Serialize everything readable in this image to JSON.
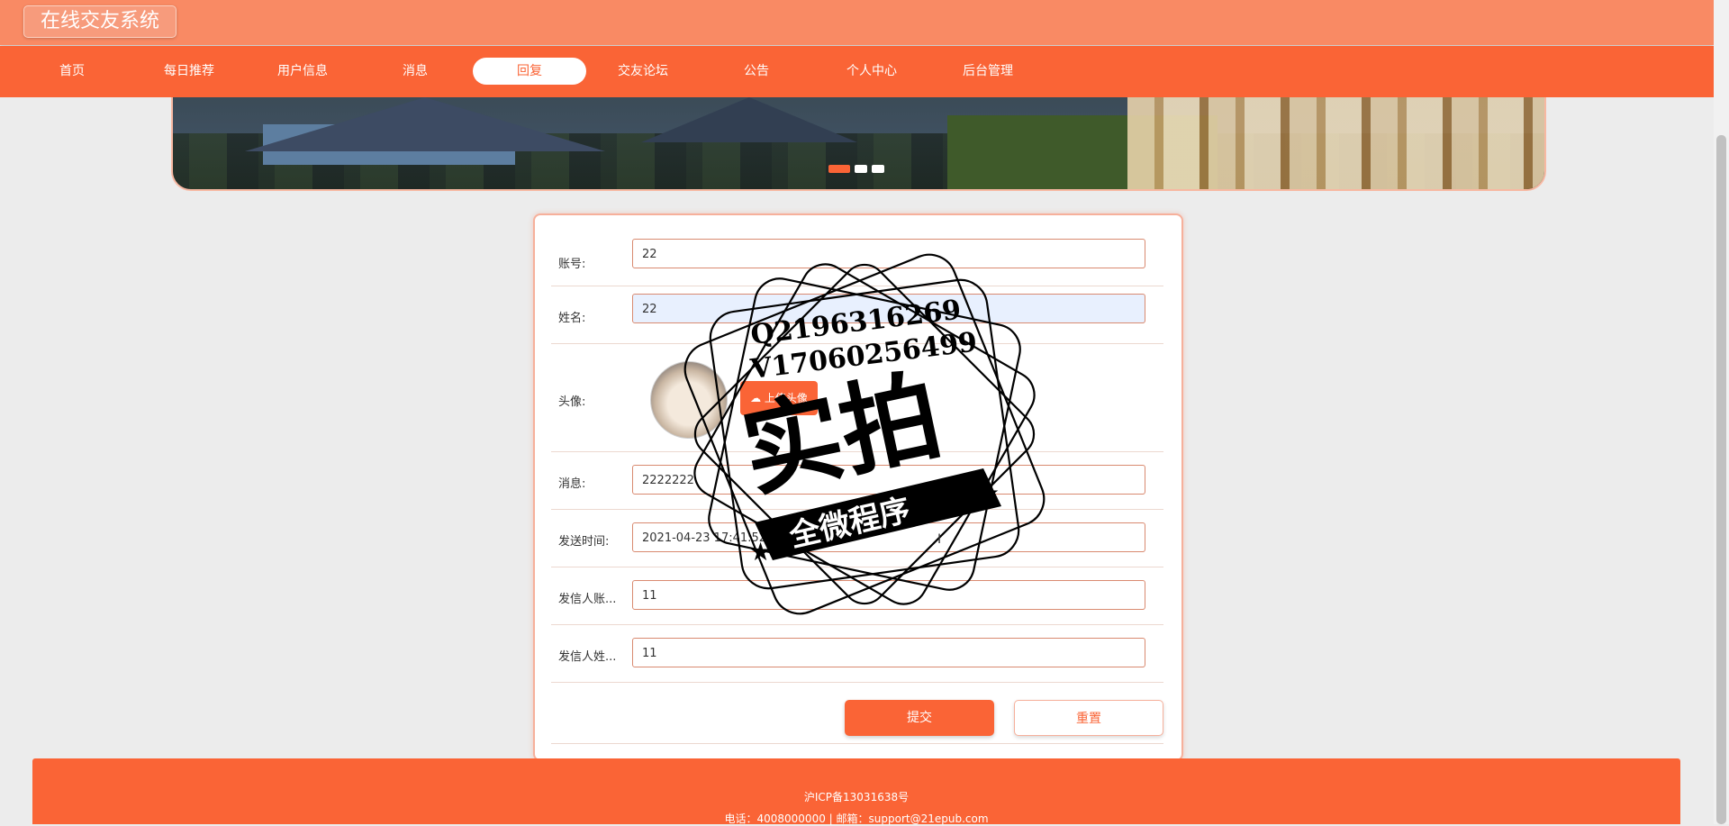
{
  "header": {
    "site_title": "在线交友系统"
  },
  "nav": {
    "items": [
      {
        "label": "首页"
      },
      {
        "label": "每日推荐"
      },
      {
        "label": "用户信息"
      },
      {
        "label": "消息"
      },
      {
        "label": "回复",
        "active": true
      },
      {
        "label": "交友论坛"
      },
      {
        "label": "公告"
      },
      {
        "label": "个人中心"
      },
      {
        "label": "后台管理"
      }
    ]
  },
  "banner": {
    "slide_count": 3,
    "active_slide": 1
  },
  "form": {
    "fields": [
      {
        "label": "账号:",
        "value": "22"
      },
      {
        "label": "姓名:",
        "value": "22"
      },
      {
        "label": "头像:"
      },
      {
        "label": "消息:",
        "value": "2222222"
      },
      {
        "label": "发送时间:",
        "value": "2021-04-23 17:41:52"
      },
      {
        "label": "发信人账...",
        "value": "11"
      },
      {
        "label": "发信人姓...",
        "value": "11"
      }
    ],
    "upload_label": "上传头像",
    "submit_label": "提交",
    "reset_label": "重置"
  },
  "watermark": {
    "line1": "Q2196316269",
    "line2": "V17060256499",
    "main": "实拍",
    "ribbon": "全微程序"
  },
  "footer": {
    "icp": "沪ICP备13031638号",
    "contact": "电话：4008000000 | 邮箱：support@21epub.com"
  },
  "colors": {
    "brand": "#fa6436",
    "header": "#f98a64",
    "background": "#ececec"
  }
}
